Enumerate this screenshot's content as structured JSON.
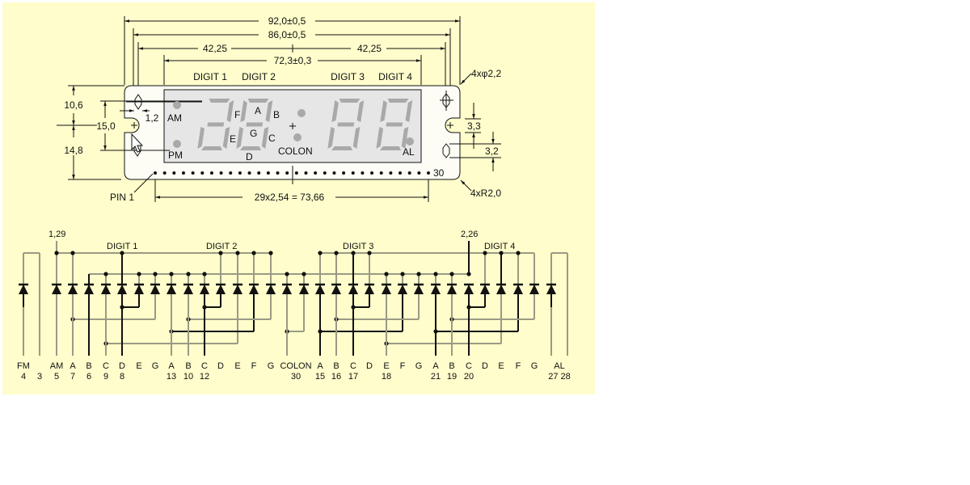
{
  "colors": {
    "background": "#fefdcb",
    "module_body": "#fdfdf5",
    "lcd_window": "#e6e6e6",
    "segment": "#a9a9a9",
    "ink": "#111111",
    "grey_wire": "#9b9a84"
  },
  "mechanical": {
    "dimensions": {
      "overall_width": "92,0±0,5",
      "hole_spacing": "86,0±0,5",
      "half_left": "42,25",
      "half_right": "42,25",
      "window_width": "72,3±0,3",
      "top_height": "10,6",
      "total_height_inner": "15,0",
      "bottom_height": "14,8",
      "hole_offset": "1,2",
      "slot_width": "3,3",
      "oval_height": "3,2",
      "hole_callout": "4xφ2,2",
      "radius_callout": "4xR2,0",
      "pin_pitch": "29x2,54 = 73,66"
    },
    "digit_labels": [
      "DIGIT 1",
      "DIGIT 2",
      "DIGIT 3",
      "DIGIT 4"
    ],
    "segment_labels": {
      "a": "A",
      "b": "B",
      "c": "C",
      "d": "D",
      "e": "E",
      "f": "F",
      "g": "G"
    },
    "indicator_labels": {
      "am": "AM",
      "pm": "PM",
      "colon": "COLON",
      "al": "AL"
    },
    "pin_first": "PIN 1",
    "pin_last": "30",
    "pin_count": 30,
    "digits_lit_segments": [
      [
        "a",
        "b",
        "c",
        "d",
        "e",
        "g"
      ],
      [
        "a",
        "b",
        "c",
        "d",
        "e",
        "f",
        "g"
      ],
      [
        "a",
        "b",
        "c",
        "d",
        "e",
        "f",
        "g"
      ],
      [
        "a",
        "b",
        "c",
        "d",
        "e",
        "f",
        "g"
      ]
    ]
  },
  "schematic": {
    "common_labels": {
      "left": "1,29",
      "right": "2,26"
    },
    "digit_labels": [
      "DIGIT 1",
      "DIGIT 2",
      "DIGIT 3",
      "DIGIT 4"
    ],
    "columns": [
      {
        "label": "FM",
        "pin": "4"
      },
      {
        "label": "",
        "pin": "3"
      },
      {
        "label": "AM",
        "pin": "5"
      },
      {
        "label": "A",
        "pin": "7"
      },
      {
        "label": "B",
        "pin": "6"
      },
      {
        "label": "C",
        "pin": "9"
      },
      {
        "label": "D",
        "pin": "8"
      },
      {
        "label": "E",
        "pin": ""
      },
      {
        "label": "G",
        "pin": ""
      },
      {
        "label": "A",
        "pin": "13"
      },
      {
        "label": "B",
        "pin": "10"
      },
      {
        "label": "C",
        "pin": "12"
      },
      {
        "label": "D",
        "pin": ""
      },
      {
        "label": "E",
        "pin": ""
      },
      {
        "label": "F",
        "pin": ""
      },
      {
        "label": "G",
        "pin": ""
      },
      {
        "label": "COLON",
        "pin": "30"
      },
      {
        "label": "A",
        "pin": "15"
      },
      {
        "label": "B",
        "pin": "16"
      },
      {
        "label": "C",
        "pin": "17"
      },
      {
        "label": "D",
        "pin": ""
      },
      {
        "label": "E",
        "pin": "18"
      },
      {
        "label": "F",
        "pin": ""
      },
      {
        "label": "G",
        "pin": ""
      },
      {
        "label": "A",
        "pin": "21"
      },
      {
        "label": "B",
        "pin": "19"
      },
      {
        "label": "C",
        "pin": "20"
      },
      {
        "label": "D",
        "pin": ""
      },
      {
        "label": "E",
        "pin": ""
      },
      {
        "label": "F",
        "pin": ""
      },
      {
        "label": "G",
        "pin": ""
      },
      {
        "label": "AL",
        "pin": "27 28"
      }
    ]
  }
}
